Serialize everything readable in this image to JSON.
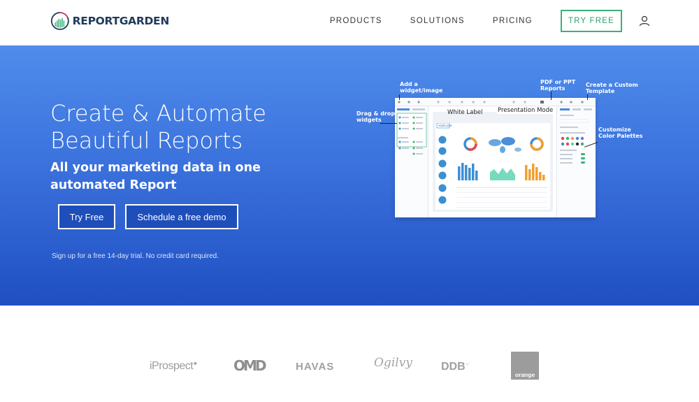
{
  "brand": {
    "name": "REPORTGARDEN"
  },
  "nav": {
    "products": "PRODUCTS",
    "solutions": "SOLUTIONS",
    "pricing": "PRICING",
    "cta": "TRY FREE"
  },
  "hero": {
    "title_line1": "Create & Automate",
    "title_line2": "Beautiful Reports",
    "subtitle": "All your marketing data in one automated Report",
    "try_free": "Try Free",
    "schedule_demo": "Schedule a free demo",
    "note": "Sign up for a free 14-day trial. No credit card required."
  },
  "screenshot": {
    "annotations": {
      "add_widget": "Add a widget/image",
      "drag_drop": "Drag & drop widgets",
      "white_label": "White Label",
      "presentation_mode": "Presentation Mode",
      "pdf_ppt": "PDF or PPT Reports",
      "custom_template": "Create a Custom Template",
      "color_palettes": "Customize Color Palettes"
    },
    "logo_text": "YOUR LOGO"
  },
  "clients": {
    "iprospect": "iProspect",
    "omd": "OMD",
    "havas": "HAVAS",
    "ogilvy": "Ogilvy",
    "ddb": "DDB",
    "orange": "orange"
  },
  "colors": {
    "accent_green": "#3ab07a",
    "hero_top": "#4f8ceb",
    "hero_bottom": "#1f4fc2",
    "chart_blue": "#3b8fd3",
    "chart_orange": "#f0a030",
    "chart_teal": "#5fd3b3"
  }
}
